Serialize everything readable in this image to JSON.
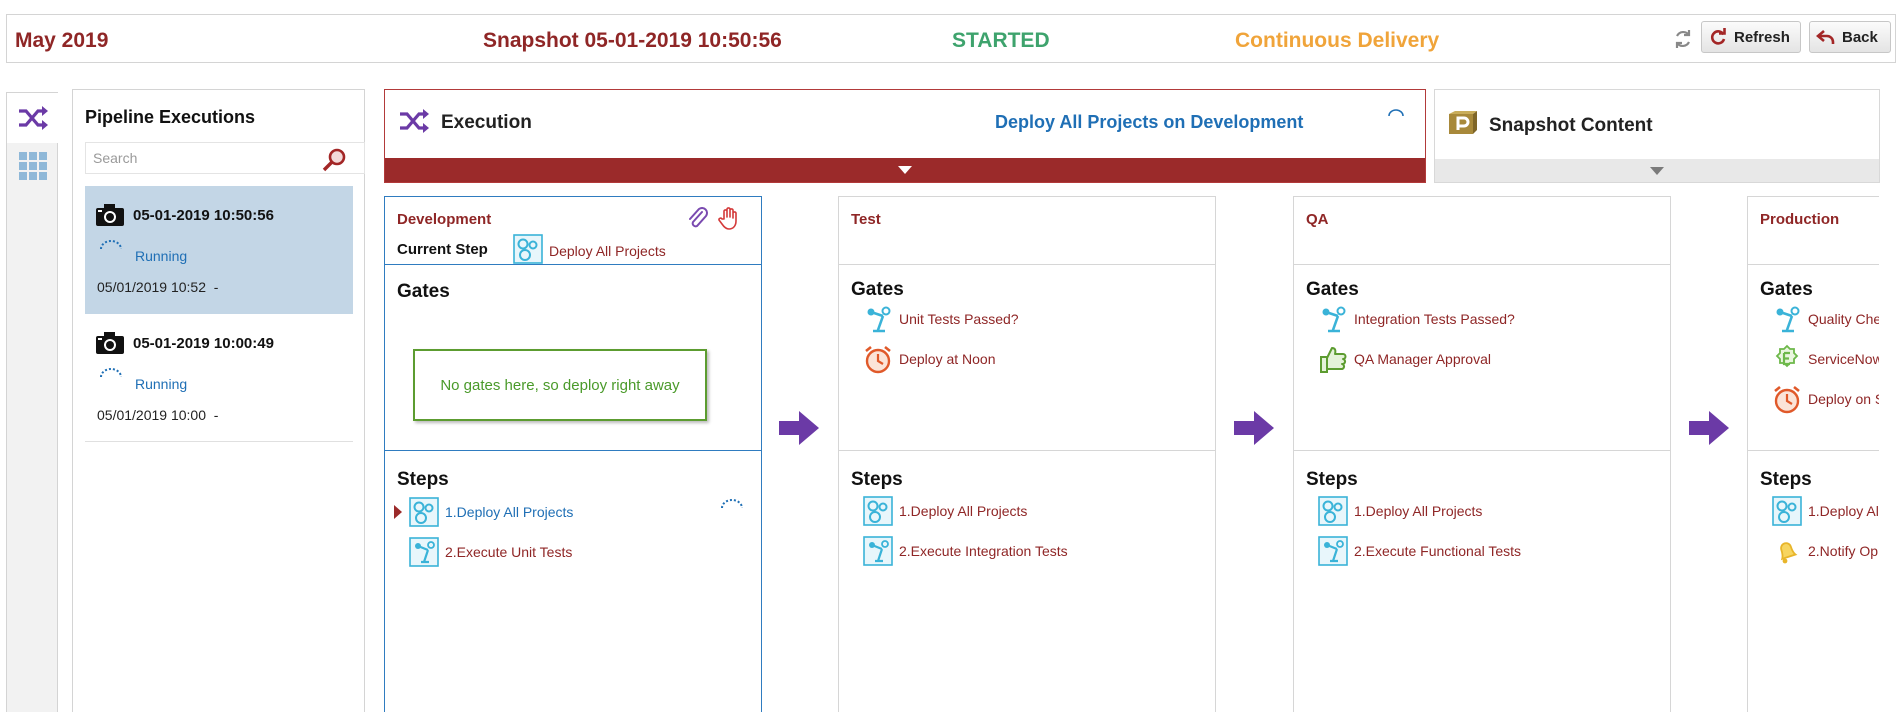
{
  "header": {
    "month": "May 2019",
    "snapshot": "Snapshot 05-01-2019 10:50:56",
    "status": "STARTED",
    "pipeline": "Continuous Delivery",
    "refresh_label": "Refresh",
    "back_label": "Back",
    "colors": {
      "title": "#8f2626",
      "status": "#3ea36d",
      "pipeline": "#f0a43a"
    }
  },
  "sidebar": {
    "items": [
      {
        "icon": "shuffle-icon",
        "active": true
      },
      {
        "icon": "grid-icon",
        "active": false
      }
    ]
  },
  "executions": {
    "title": "Pipeline Executions",
    "search_placeholder": "Search",
    "items": [
      {
        "snapshot": "05-01-2019 10:50:56",
        "status": "Running",
        "time": "05/01/2019 10:52  -",
        "selected": true
      },
      {
        "snapshot": "05-01-2019 10:00:49",
        "status": "Running",
        "time": "05/01/2019 10:00  -",
        "selected": false
      }
    ]
  },
  "execution_card": {
    "label": "Execution",
    "deploy_text": "Deploy All Projects on Development"
  },
  "snapshot_card": {
    "label": "Snapshot Content"
  },
  "stages": [
    {
      "name": "Development",
      "current_step_label": "Current Step",
      "current_step": "Deploy All Projects",
      "gates_title": "Gates",
      "no_gates_message": "No gates here, so deploy right away",
      "steps_title": "Steps",
      "steps": [
        {
          "label": "1.Deploy All Projects",
          "icon": "deploy-icon",
          "active": true
        },
        {
          "label": "2.Execute Unit Tests",
          "icon": "test-robot-icon",
          "active": false
        }
      ]
    },
    {
      "name": "Test",
      "gates_title": "Gates",
      "gates": [
        {
          "label": "Unit Tests Passed?",
          "icon": "test-robot-icon"
        },
        {
          "label": "Deploy at Noon",
          "icon": "alarm-clock-icon"
        }
      ],
      "steps_title": "Steps",
      "steps": [
        {
          "label": "1.Deploy All Projects",
          "icon": "deploy-icon"
        },
        {
          "label": "2.Execute Integration Tests",
          "icon": "test-robot-icon"
        }
      ]
    },
    {
      "name": "QA",
      "gates_title": "Gates",
      "gates": [
        {
          "label": "Integration Tests Passed?",
          "icon": "test-robot-icon"
        },
        {
          "label": "QA Manager Approval",
          "icon": "thumbs-up-icon"
        }
      ],
      "steps_title": "Steps",
      "steps": [
        {
          "label": "1.Deploy All Projects",
          "icon": "deploy-icon"
        },
        {
          "label": "2.Execute Functional Tests",
          "icon": "test-robot-icon"
        }
      ]
    },
    {
      "name": "Production",
      "gates_title": "Gates",
      "gates": [
        {
          "label": "Quality Che",
          "icon": "test-robot-icon"
        },
        {
          "label": "ServiceNow",
          "icon": "servicenow-icon"
        },
        {
          "label": "Deploy on S",
          "icon": "alarm-clock-icon"
        }
      ],
      "steps_title": "Steps",
      "steps": [
        {
          "label": "1.Deploy Al",
          "icon": "deploy-icon"
        },
        {
          "label": "2.Notify Op",
          "icon": "bell-icon"
        }
      ]
    }
  ]
}
